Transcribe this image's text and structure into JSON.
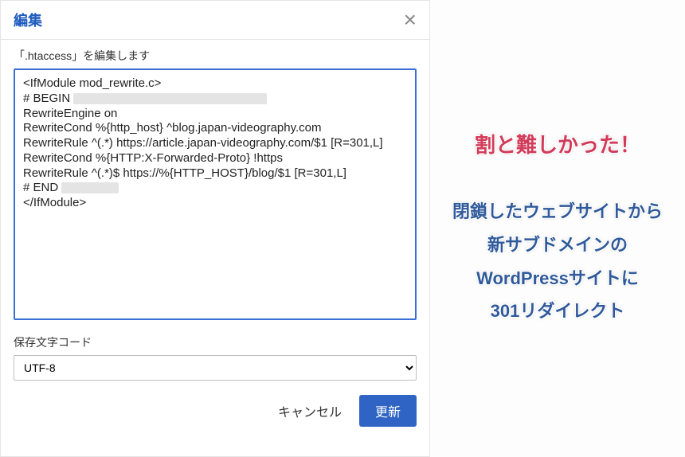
{
  "modal": {
    "title": "編集",
    "file_label": "「.htaccess」を編集します",
    "code_lines": [
      "<IfModule mod_rewrite.c>",
      "# BEGIN ███████████████████████████",
      "RewriteEngine on",
      "RewriteCond %{http_host} ^blog.japan-videography.com",
      "RewriteRule ^(.*) https://article.japan-videography.com/$1 [R=301,L]",
      "RewriteCond %{HTTP:X-Forwarded-Proto} !https",
      "RewriteRule ^(.*)$ https://%{HTTP_HOST}/blog/$1 [R=301,L]",
      "# END ████████",
      "</IfModule>"
    ],
    "encoding_label": "保存文字コード",
    "encoding_value": "UTF-8",
    "cancel": "キャンセル",
    "submit": "更新"
  },
  "caption": {
    "headline": "割と難しかった！",
    "body_lines": [
      "閉鎖したウェブサイトから",
      "新サブドメインの",
      "WordPressサイトに",
      "301リダイレクト"
    ]
  }
}
